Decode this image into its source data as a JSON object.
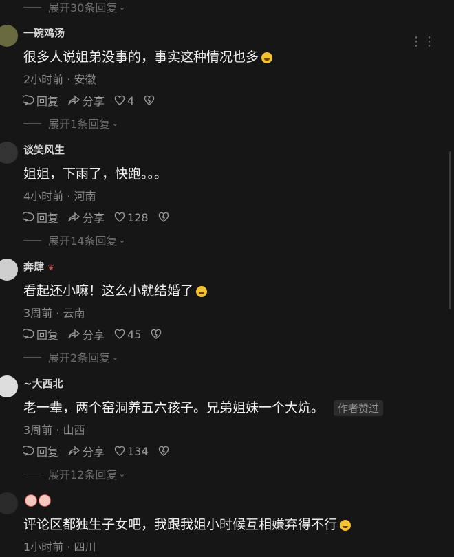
{
  "top_expand": "展开30条回复",
  "comments": [
    {
      "user": "一碗鸡汤",
      "text": "很多人说姐弟没事的，事实这种情况也多",
      "time": "2小时前 · 安徽",
      "reply": "回复",
      "share": "分享",
      "likes": "4",
      "expand": "展开1条回复"
    },
    {
      "user": "谈笑风生",
      "text": "姐姐，下雨了，快跑。。。",
      "time": "4小时前 · 河南",
      "reply": "回复",
      "share": "分享",
      "likes": "128",
      "expand": "展开14条回复"
    },
    {
      "user": "奔肆",
      "text": "看起还小嘛！这么小就结婚了",
      "time": "3周前 · 云南",
      "reply": "回复",
      "share": "分享",
      "likes": "45",
      "expand": "展开2条回复"
    },
    {
      "user": "~大西北",
      "text": "老一辈，两个窑洞养五六孩子。兄弟姐妹一个大炕。",
      "badge": "作者赞过",
      "time": "3周前 · 山西",
      "reply": "回复",
      "share": "分享",
      "likes": "134",
      "expand": "展开12条回复"
    },
    {
      "user": "",
      "text": "评论区都独生子女吧，我跟我姐小时候互相嫌弃得不行",
      "time": "1小时前 · 四川"
    }
  ],
  "more_icon": "more-dots-icon",
  "colors": {
    "background": "#161616",
    "text": "#f0f0f0",
    "muted": "#8a8a8a"
  }
}
